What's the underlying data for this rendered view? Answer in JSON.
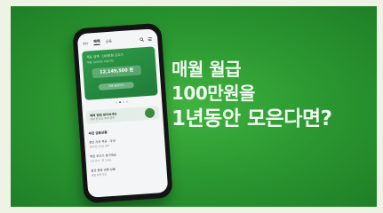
{
  "phone": {
    "nav": {
      "tabs": [
        "MY",
        "혜택",
        "금융"
      ],
      "active_index": 1
    },
    "card": {
      "line1": "목표 금액 · 100만원 모으기",
      "line2": "매월 100만원 자동이체",
      "amount": "12,149,500 원",
      "button": "목표 달성하기"
    },
    "carousel": {
      "count": 4,
      "active": 1
    },
    "promo": {
      "line1": "혜택 알림 받아보세요",
      "line2": "최대 연 4% 우대 금리"
    },
    "section_title": "추천 금융상품",
    "items": [
      {
        "title": "청년 자유 적금 · 우대",
        "sub": "최대 연 4.5% 금리"
      },
      {
        "title": "목돈 모으기 정기예금",
        "sub": "1년 만기 · 연 3.6%"
      },
      {
        "title": "월급 통장 연결 상품",
        "sub": "매월 자동 저축"
      }
    ]
  },
  "headline": {
    "line1": "매월 월급",
    "line2": "100만원을",
    "line3": "1년동안 모은다면?"
  },
  "colors": {
    "banner": "#2c9a32",
    "headline": "#ffffff"
  }
}
